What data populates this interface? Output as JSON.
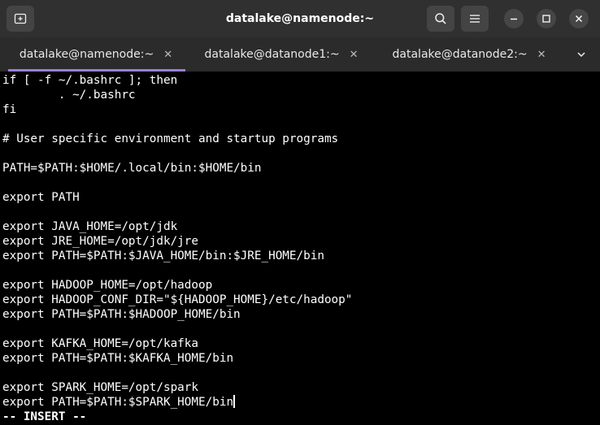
{
  "window": {
    "title": "datalake@namenode:~"
  },
  "header": {
    "new_tab_icon": "new-tab-icon",
    "search_icon": "search-icon",
    "menu_icon": "hamburger-menu-icon"
  },
  "tabs": [
    {
      "label": "datalake@namenode:~",
      "active": true
    },
    {
      "label": "datalake@datanode1:~",
      "active": false
    },
    {
      "label": "datalake@datanode2:~",
      "active": false
    }
  ],
  "terminal": {
    "lines": [
      "if [ -f ~/.bashrc ]; then",
      "        . ~/.bashrc",
      "fi",
      "",
      "# User specific environment and startup programs",
      "",
      "PATH=$PATH:$HOME/.local/bin:$HOME/bin",
      "",
      "export PATH",
      "",
      "export JAVA_HOME=/opt/jdk",
      "export JRE_HOME=/opt/jdk/jre",
      "export PATH=$PATH:$JAVA_HOME/bin:$JRE_HOME/bin",
      "",
      "export HADOOP_HOME=/opt/hadoop",
      "export HADOOP_CONF_DIR=\"${HADOOP_HOME}/etc/hadoop\"",
      "export PATH=$PATH:$HADOOP_HOME/bin",
      "",
      "export KAFKA_HOME=/opt/kafka",
      "export PATH=$PATH:$KAFKA_HOME/bin",
      "",
      "export SPARK_HOME=/opt/spark",
      "export PATH=$PATH:$SPARK_HOME/bin"
    ],
    "status": "-- INSERT --"
  },
  "colors": {
    "headerbar": "#303030",
    "tabbar": "#2b2b2b",
    "terminal_bg": "#000000",
    "terminal_fg": "#ffffff",
    "active_tab_accent": "#9b7fd4"
  }
}
